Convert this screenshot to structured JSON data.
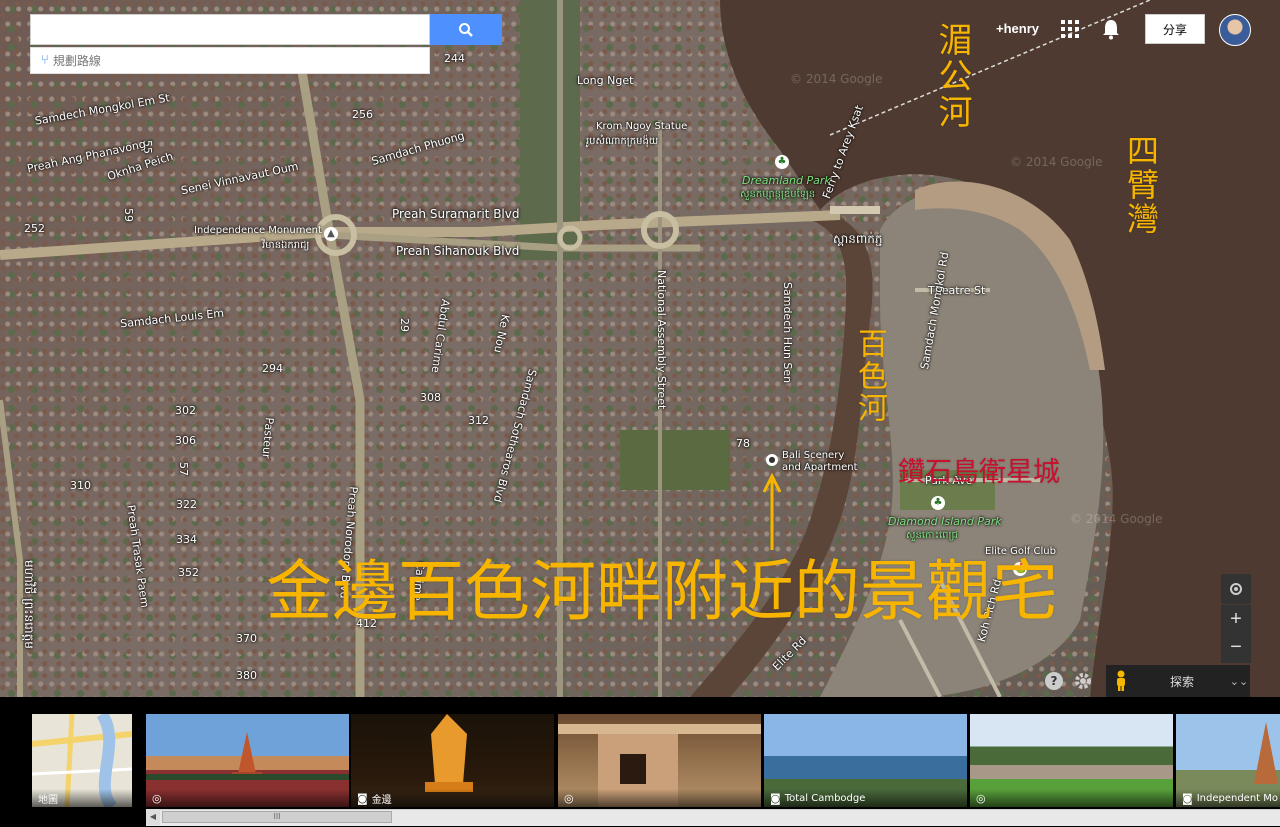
{
  "search": {
    "value": "",
    "placeholder": "",
    "directions_label": "規劃路線"
  },
  "header": {
    "user": "+henry",
    "share_label": "分享"
  },
  "map": {
    "road_labels": {
      "r244": "244",
      "r256": "256",
      "r252": "252",
      "r294": "294",
      "r302": "302",
      "r306": "306",
      "r308": "308",
      "r310": "310",
      "r312": "312",
      "r322": "322",
      "r334": "334",
      "r352": "352",
      "r370": "370",
      "r380": "380",
      "r412": "412",
      "r78": "78",
      "r57": "57",
      "r59": "59",
      "r55": "55",
      "r29": "29",
      "mongkol": "Samdech Mongkol Em St",
      "phanavong": "Preah Ang Phanavong",
      "oknhapeich": "Oknha Peich",
      "senei": "Senei Vinnavaut Oum",
      "phuong": "Samdach Phuong",
      "suramarit": "Preah Suramarit Blvd",
      "sihanouk": "Preah Sihanouk Blvd",
      "louisem": "Samdach Louis Em",
      "abdul": "Abdul Carime",
      "kenou": "Ke Nou",
      "sothearos": "Samdach Sothearos Blvd",
      "national": "National Assembly Street",
      "hunsen": "Samdech Hun Sen",
      "norodom": "Preah Norodom Blvd",
      "pasteur": "Pasteur",
      "trasak": "Preah Trasak Paem",
      "carime2": "Carime",
      "theatre": "Theatre St",
      "mongkolrd": "Samdach Mongkol Rd",
      "parkave": "Park Ave",
      "kohpich": "Koh Pich Rd",
      "elite": "Elite Rd",
      "ferry": "Ferry to Arey Ksat",
      "khmer1": "ស្ពានពាក់ភ្ជ",
      "khmer_left": "មហាវិថី ព្រះនរោត្តម"
    },
    "places": {
      "long_nget": "Long Nget",
      "krom_ngoy": "Krom Ngoy Statue",
      "krom_ngoy_km": "រូបសំណាកក្រមង៉ុយ",
      "independence": "Independence Monument",
      "independence_km": "វិមានឯករាជ្យ",
      "dreamland": "Dreamland Park",
      "dreamland_km": "សួនកម្សាន្តឌ្រីមឡែន",
      "bali": "Bali Scenery",
      "bali2": "and Apartment",
      "diamond": "Diamond Island Park",
      "diamond_km": "សួនកោះពេជ្រ",
      "elite_golf": "Elite Golf Club"
    },
    "annotations": {
      "mekong": "湄公河",
      "four_arms": "四臂灣",
      "bassac": "百色河",
      "diamond_city": "鑽石島衛星城",
      "headline": "金邊百色河畔附近的景觀宅"
    },
    "watermark": "© 2014 Google",
    "controls": {
      "zoom_in": "+",
      "zoom_out": "−",
      "explore_label": "探索"
    }
  },
  "strip": {
    "thumbs": [
      {
        "label": "地圖",
        "icon": "map-thumb"
      },
      {
        "label": "",
        "icon": "sphere-icon"
      },
      {
        "label": "金邊",
        "icon": "camera-icon"
      },
      {
        "label": "",
        "icon": "sphere-icon"
      },
      {
        "label": "Total Cambodge",
        "icon": "camera-icon"
      },
      {
        "label": "",
        "icon": "sphere-icon"
      },
      {
        "label": "Independent Mo",
        "icon": "camera-icon"
      }
    ],
    "scroll_thumb_label": "III"
  },
  "colors": {
    "annotation_orange": "#f7b500",
    "annotation_red": "#c8102e",
    "search_blue": "#4d90fe",
    "river": "#5b4538"
  }
}
